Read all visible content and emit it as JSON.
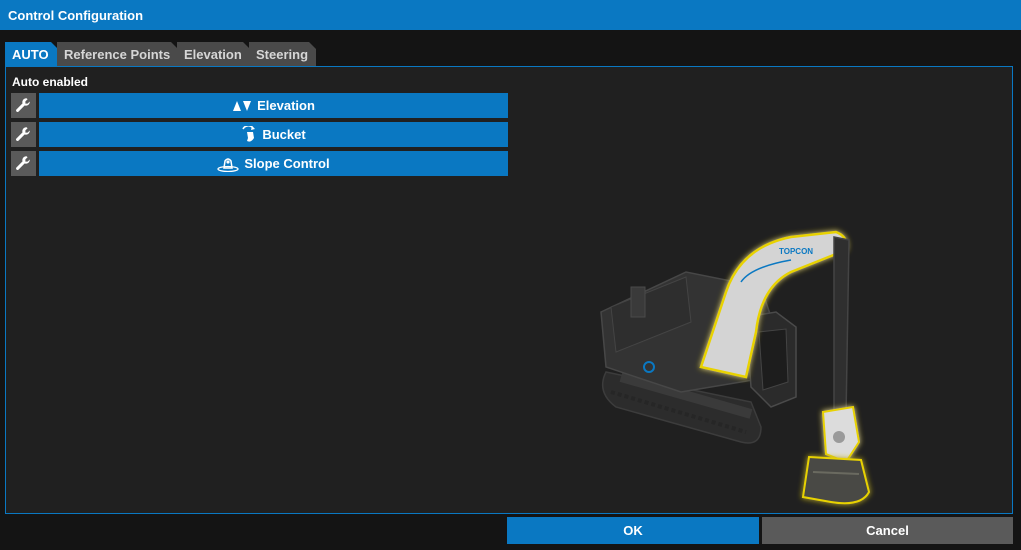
{
  "window": {
    "title": "Control Configuration"
  },
  "tabs": [
    {
      "label": "AUTO",
      "active": true
    },
    {
      "label": "Reference Points",
      "active": false
    },
    {
      "label": "Elevation",
      "active": false
    },
    {
      "label": "Steering",
      "active": false
    }
  ],
  "auto": {
    "section_label": "Auto enabled",
    "functions": [
      {
        "label": "Elevation",
        "icon": "elevation-arrows-icon"
      },
      {
        "label": "Bucket",
        "icon": "bucket-icon"
      },
      {
        "label": "Slope Control",
        "icon": "slope-control-icon"
      }
    ]
  },
  "illustration": {
    "brand_text": "TOPCON",
    "icon": "excavator-illustration"
  },
  "footer": {
    "ok_label": "OK",
    "cancel_label": "Cancel"
  },
  "colors": {
    "accent": "#0a78c2",
    "tab_inactive": "#4a4a4a",
    "button_gray": "#5a5a5a",
    "panel_bg": "#202020",
    "highlight": "#e8d200"
  }
}
